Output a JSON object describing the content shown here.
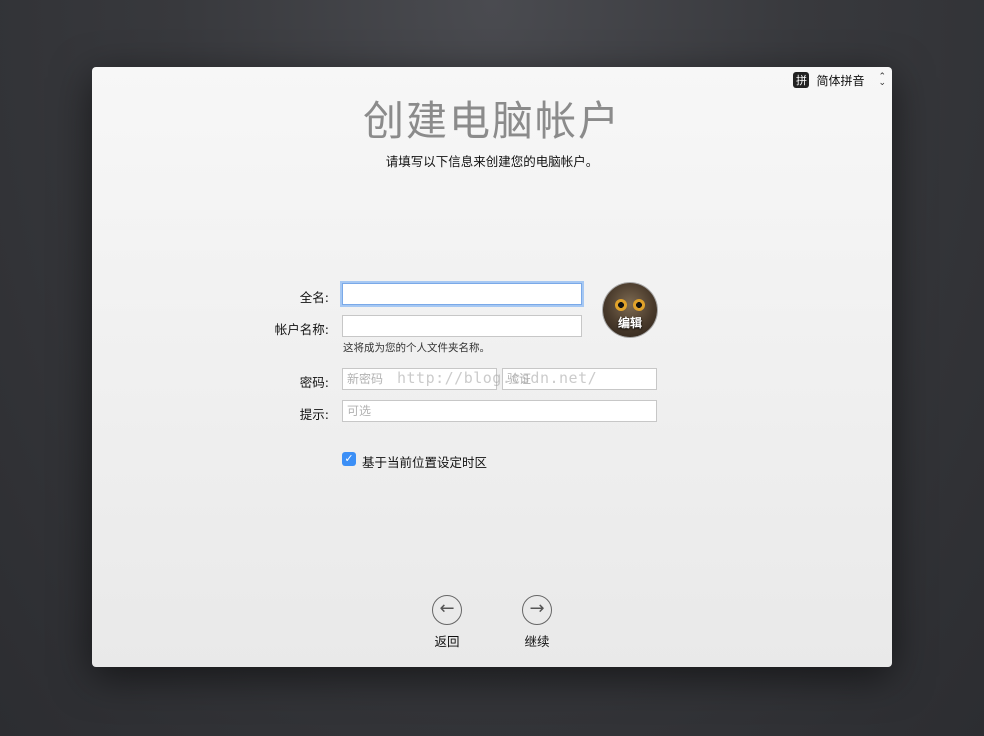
{
  "ime": {
    "badge": "拼",
    "label": "简体拼音",
    "arrow_up": "⌃",
    "arrow_down": "⌄"
  },
  "header": {
    "title": "创建电脑帐户",
    "subtitle": "请填写以下信息来创建您的电脑帐户。"
  },
  "form": {
    "fullname_label": "全名:",
    "fullname_value": "",
    "account_label": "帐户名称:",
    "account_value": "",
    "account_hint": "这将成为您的个人文件夹名称。",
    "password_label": "密码:",
    "password_placeholder": "新密码",
    "verify_placeholder": "验证",
    "hint_label": "提示:",
    "hint_placeholder": "可选"
  },
  "avatar": {
    "edit_label": "编辑"
  },
  "watermark": "http://blog.csdn.net/",
  "timezone": {
    "label": "基于当前位置设定时区",
    "checked": true,
    "checkmark": "✓"
  },
  "nav": {
    "back_label": "返回",
    "back_icon": "←",
    "continue_label": "继续",
    "continue_icon": "→"
  },
  "colors": {
    "accent": "#3b8ff6",
    "focus": "#7aa9e8"
  }
}
